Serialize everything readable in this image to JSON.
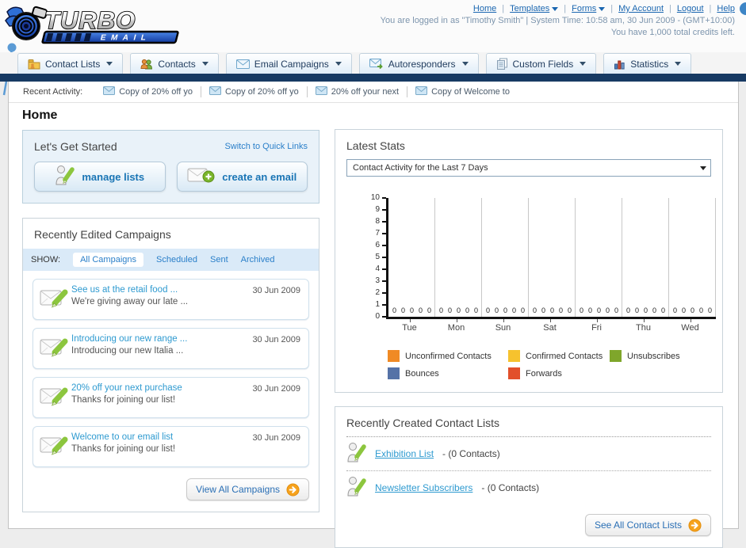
{
  "header": {
    "logo": {
      "title": "TURBO",
      "subtitle": "EMAIL"
    },
    "nav_links": [
      {
        "label": "Home",
        "dropdown": false
      },
      {
        "label": "Templates",
        "dropdown": true
      },
      {
        "label": "Forms",
        "dropdown": true
      },
      {
        "label": "My Account",
        "dropdown": false
      },
      {
        "label": "Logout",
        "dropdown": false
      },
      {
        "label": "Help",
        "dropdown": false
      }
    ],
    "login_info": "You are logged in as \"Timothy Smith\" | System Time: 10:58 am, 30 Jun 2009 - (GMT+10:00)",
    "credits_info": "You have 1,000 total credits left."
  },
  "nav_tabs": [
    {
      "label": "Contact Lists",
      "icon": "contact-lists-folder-icon"
    },
    {
      "label": "Contacts",
      "icon": "contacts-people-icon"
    },
    {
      "label": "Email Campaigns",
      "icon": "email-envelope-icon"
    },
    {
      "label": "Autoresponders",
      "icon": "autoresponder-envelope-icon"
    },
    {
      "label": "Custom Fields",
      "icon": "custom-fields-pages-icon"
    },
    {
      "label": "Statistics",
      "icon": "statistics-chart-icon"
    }
  ],
  "recent_activity": {
    "label": "Recent Activity:",
    "items": [
      "Copy of 20% off yo",
      "Copy of 20% off yo",
      "20% off your next",
      "Copy of Welcome to"
    ]
  },
  "page_title": "Home",
  "get_started": {
    "title": "Let's Get Started",
    "switch_link": "Switch to Quick Links",
    "buttons": [
      {
        "label": "manage lists",
        "icon": "person-pencil-icon"
      },
      {
        "label": "create an email",
        "icon": "envelope-plus-icon"
      }
    ]
  },
  "campaigns_panel": {
    "title": "Recently Edited Campaigns",
    "show_label": "SHOW:",
    "tabs": [
      {
        "label": "All Campaigns",
        "active": true
      },
      {
        "label": "Scheduled",
        "active": false
      },
      {
        "label": "Sent",
        "active": false
      },
      {
        "label": "Archived",
        "active": false
      }
    ],
    "items": [
      {
        "title": "See us at the retail food ...",
        "subtitle": "We're giving away our late ...",
        "date": "30 Jun 2009",
        "icon": "envelope-pencil-icon"
      },
      {
        "title": "Introducing our new range ...",
        "subtitle": "Introducing our new Italia ...",
        "date": "30 Jun 2009",
        "icon": "envelope-pencil-icon"
      },
      {
        "title": "20% off your next purchase",
        "subtitle": "Thanks for joining our list!",
        "date": "30 Jun 2009",
        "icon": "envelope-pencil-icon"
      },
      {
        "title": "Welcome to our email list",
        "subtitle": "Thanks for joining our list!",
        "date": "30 Jun 2009",
        "icon": "envelope-pencil-icon"
      }
    ],
    "view_all_label": "View All Campaigns"
  },
  "stats_panel": {
    "title": "Latest Stats",
    "filter_value": "Contact Activity for the Last 7 Days"
  },
  "chart_data": {
    "type": "bar",
    "title": "Contact Activity for the Last 7 Days",
    "categories": [
      "Tue",
      "Mon",
      "Sun",
      "Sat",
      "Fri",
      "Thu",
      "Wed"
    ],
    "series": [
      {
        "name": "Unconfirmed Contacts",
        "color": "#f08a24",
        "values": [
          0,
          0,
          0,
          0,
          0,
          0,
          0
        ]
      },
      {
        "name": "Confirmed Contacts",
        "color": "#f6c22e",
        "values": [
          0,
          0,
          0,
          0,
          0,
          0,
          0
        ]
      },
      {
        "name": "Unsubscribes",
        "color": "#7fa62b",
        "values": [
          0,
          0,
          0,
          0,
          0,
          0,
          0
        ]
      },
      {
        "name": "Bounces",
        "color": "#5572a7",
        "values": [
          0,
          0,
          0,
          0,
          0,
          0,
          0
        ]
      },
      {
        "name": "Forwards",
        "color": "#e2502b",
        "values": [
          0,
          0,
          0,
          0,
          0,
          0,
          0
        ]
      }
    ],
    "xlabel": "",
    "ylabel": "",
    "ylim": [
      0,
      10
    ],
    "yticks": [
      0,
      1,
      2,
      3,
      4,
      5,
      6,
      7,
      8,
      9,
      10
    ],
    "grid": true,
    "legend_position": "bottom"
  },
  "contact_lists_panel": {
    "title": "Recently Created Contact Lists",
    "items": [
      {
        "name": "Exhibition List",
        "detail": "- (0 Contacts)",
        "icon": "person-pencil-icon"
      },
      {
        "name": "Newsletter Subscribers",
        "detail": "- (0 Contacts)",
        "icon": "person-pencil-icon"
      }
    ],
    "see_all_label": "See All Contact Lists"
  }
}
